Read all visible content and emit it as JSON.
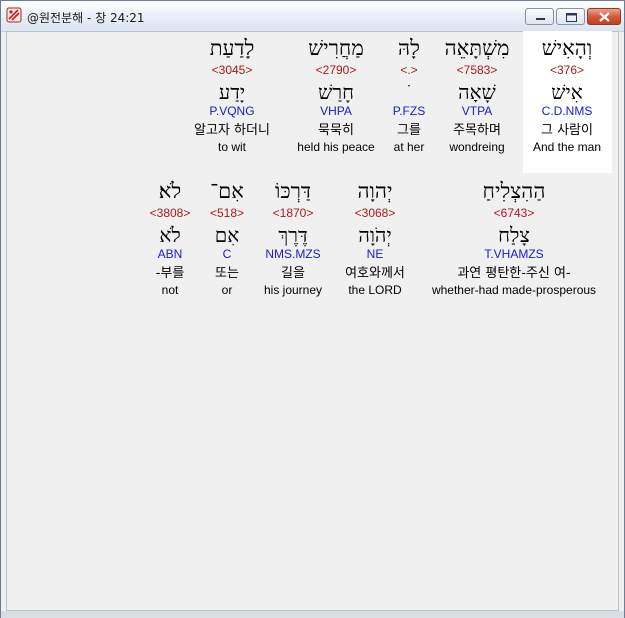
{
  "window": {
    "title": "@원전분해 - 창 24:21"
  },
  "colors": {
    "strong": "#aa1a1a",
    "morph": "#1a1ac8",
    "highlight": "#ffffff"
  },
  "rows": [
    {
      "words": [
        {
          "hebrew": "וְהָאִישׁ",
          "strong": "<376>",
          "lemma": "אִישׁ",
          "morph": "C.D.NMS",
          "korean": "그 사람이",
          "english": "And the man"
        },
        {
          "hebrew": "מִשְׁתָּאֵה",
          "strong": "<7583>",
          "lemma": "שָׁאָה",
          "morph": "VTPA",
          "korean": "주목하며",
          "english": "wondreing"
        },
        {
          "hebrew": "לָהּ",
          "strong": "<.>",
          "lemma": "ׂ",
          "morph": "P.FZS",
          "korean": "그를",
          "english": "at her"
        },
        {
          "hebrew": "מַחֲרִישׁ",
          "strong": "<2790>",
          "lemma": "חָרַשׁ",
          "morph": "VHPA",
          "korean": "묵묵히",
          "english": "held his peace"
        },
        {
          "hebrew": "לָדַעַת",
          "strong": "<3045>",
          "lemma": "יָדַע",
          "morph": "P.VQNG",
          "korean": "알고자 하더니",
          "english": "to wit"
        }
      ]
    },
    {
      "words": [
        {
          "hebrew": "הַהִצְלִיחַ",
          "strong": "<6743>",
          "lemma": "צָלַח",
          "morph": "T.VHAMZS",
          "korean": "과연 평탄한-주신 여-",
          "english": "whether-had made-prosperous"
        },
        {
          "hebrew": "יְהוָה",
          "strong": "<3068>",
          "lemma": "יְהֹוָה",
          "morph": "NE",
          "korean": "여호와께서",
          "english": "the LORD"
        },
        {
          "hebrew": "דַּרְכּוֹ",
          "strong": "<1870>",
          "lemma": "דֶּרֶךְ",
          "morph": "NMS.MZS",
          "korean": "길을",
          "english": "his journey"
        },
        {
          "hebrew": "אִם־",
          "strong": "<518>",
          "lemma": "אִם",
          "morph": "C",
          "korean": "또는",
          "english": "or"
        },
        {
          "hebrew": "לֹא׃",
          "strong": "<3808>",
          "lemma": "לֹא",
          "morph": "ABN",
          "korean": "-부를",
          "english": "not"
        }
      ]
    }
  ]
}
